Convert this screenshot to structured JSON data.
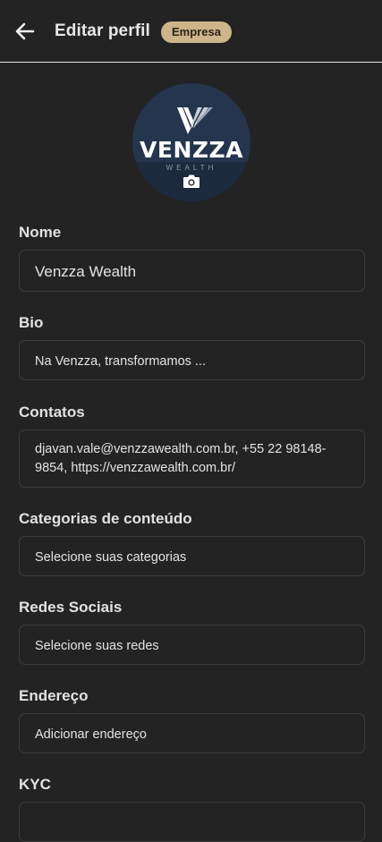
{
  "header": {
    "title": "Editar perfil",
    "badge": "Empresa"
  },
  "avatar": {
    "brand": "VENZZA",
    "sub": "WEALTH"
  },
  "form": {
    "nome": {
      "label": "Nome",
      "value": "Venzza Wealth"
    },
    "bio": {
      "label": "Bio",
      "value": "Na Venzza, transformamos ..."
    },
    "contatos": {
      "label": "Contatos",
      "value": "djavan.vale@venzzawealth.com.br, +55 22 98148-9854, https://venzzawealth.com.br/"
    },
    "categorias": {
      "label": "Categorias de conteúdo",
      "placeholder": "Selecione suas categorias"
    },
    "redes": {
      "label": "Redes Sociais",
      "placeholder": "Selecione suas redes"
    },
    "endereco": {
      "label": "Endereço",
      "placeholder": "Adicionar endereço"
    },
    "kyc": {
      "label": "KYC"
    }
  },
  "icons": {
    "back": "arrow-left-icon",
    "camera": "camera-icon"
  },
  "colors": {
    "background": "#232323",
    "badge": "#cdb48a",
    "field_border": "#3c3c3c",
    "divider": "#e9e9e9"
  }
}
